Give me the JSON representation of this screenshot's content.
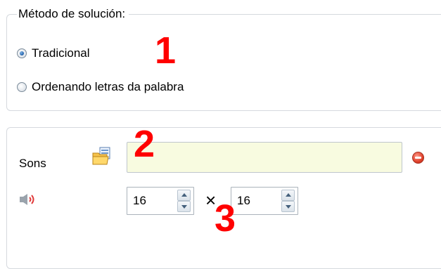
{
  "solution_group": {
    "legend": "Método de solución:",
    "options": [
      {
        "label": "Tradicional",
        "checked": true
      },
      {
        "label": "Ordenando letras da palabra",
        "checked": false
      }
    ]
  },
  "sound_group": {
    "label": "Sons",
    "path_value": "",
    "width_value": "16",
    "height_value": "16",
    "times_symbol": "×"
  },
  "markers": [
    "1",
    "2",
    "3"
  ],
  "colors": {
    "marker": "#ff0000",
    "input_background": "#f8fbe0",
    "remove_button": "#e0412b",
    "radio_checked": "#1f5fa8"
  },
  "icons": {
    "browse": "folder-icon",
    "remove": "remove-icon",
    "sound": "speaker-icon"
  }
}
